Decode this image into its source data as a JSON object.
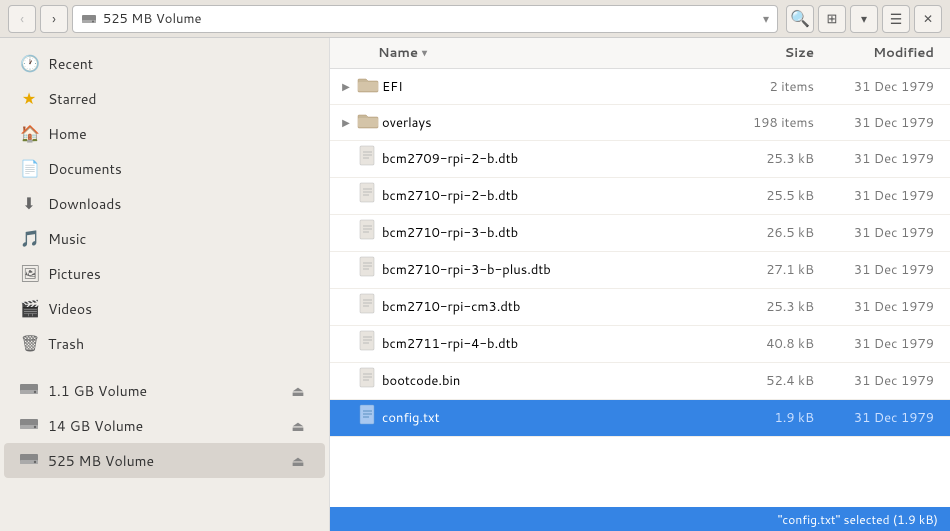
{
  "titlebar": {
    "back_label": "‹",
    "forward_label": "›",
    "location": "525 MB Volume",
    "location_icon": "drive",
    "dropdown_arrow": "▾",
    "search_icon": "🔍",
    "view_grid_icon": "⊞",
    "view_options_icon": "▾",
    "menu_icon": "☰",
    "close_icon": "✕"
  },
  "sidebar": {
    "items": [
      {
        "id": "recent",
        "label": "Recent",
        "icon": "🕐"
      },
      {
        "id": "starred",
        "label": "Starred",
        "icon": "★"
      },
      {
        "id": "home",
        "label": "Home",
        "icon": "⌂"
      },
      {
        "id": "documents",
        "label": "Documents",
        "icon": "📄"
      },
      {
        "id": "downloads",
        "label": "Downloads",
        "icon": "⬇"
      },
      {
        "id": "music",
        "label": "Music",
        "icon": "♪"
      },
      {
        "id": "pictures",
        "label": "Pictures",
        "icon": "🖼"
      },
      {
        "id": "videos",
        "label": "Videos",
        "icon": "▶"
      },
      {
        "id": "trash",
        "label": "Trash",
        "icon": "🗑"
      }
    ],
    "volumes": [
      {
        "id": "vol-1gb",
        "label": "1.1 GB Volume",
        "icon": "💾",
        "eject": true
      },
      {
        "id": "vol-14gb",
        "label": "14 GB Volume",
        "icon": "💾",
        "eject": true
      },
      {
        "id": "vol-525mb",
        "label": "525 MB Volume",
        "icon": "💾",
        "eject": true,
        "active": true
      }
    ]
  },
  "file_list": {
    "col_name": "Name",
    "col_sort_arrow": "▾",
    "col_size": "Size",
    "col_modified": "Modified",
    "files": [
      {
        "id": "efi",
        "name": "EFI",
        "type": "folder",
        "size": "2 items",
        "modified": "31 Dec 1979",
        "expandable": true
      },
      {
        "id": "overlays",
        "name": "overlays",
        "type": "folder",
        "size": "198 items",
        "modified": "31 Dec 1979",
        "expandable": true
      },
      {
        "id": "bcm2709-rpi-2-b.dtb",
        "name": "bcm2709-rpi-2-b.dtb",
        "type": "file",
        "size": "25.3 kB",
        "modified": "31 Dec 1979",
        "expandable": false
      },
      {
        "id": "bcm2710-rpi-2-b.dtb",
        "name": "bcm2710-rpi-2-b.dtb",
        "type": "file",
        "size": "25.5 kB",
        "modified": "31 Dec 1979",
        "expandable": false
      },
      {
        "id": "bcm2710-rpi-3-b.dtb",
        "name": "bcm2710-rpi-3-b.dtb",
        "type": "file",
        "size": "26.5 kB",
        "modified": "31 Dec 1979",
        "expandable": false
      },
      {
        "id": "bcm2710-rpi-3-b-plus.dtb",
        "name": "bcm2710-rpi-3-b-plus.dtb",
        "type": "file",
        "size": "27.1 kB",
        "modified": "31 Dec 1979",
        "expandable": false
      },
      {
        "id": "bcm2710-rpi-cm3.dtb",
        "name": "bcm2710-rpi-cm3.dtb",
        "type": "file",
        "size": "25.3 kB",
        "modified": "31 Dec 1979",
        "expandable": false
      },
      {
        "id": "bcm2711-rpi-4-b.dtb",
        "name": "bcm2711-rpi-4-b.dtb",
        "type": "file",
        "size": "40.8 kB",
        "modified": "31 Dec 1979",
        "expandable": false
      },
      {
        "id": "bootcode.bin",
        "name": "bootcode.bin",
        "type": "file",
        "size": "52.4 kB",
        "modified": "31 Dec 1979",
        "expandable": false
      },
      {
        "id": "config.txt",
        "name": "config.txt",
        "type": "file",
        "size": "1.9 kB",
        "modified": "31 Dec 1979",
        "expandable": false,
        "selected": true
      }
    ]
  },
  "status": {
    "text": "\"config.txt\" selected (1.9 kB)"
  }
}
